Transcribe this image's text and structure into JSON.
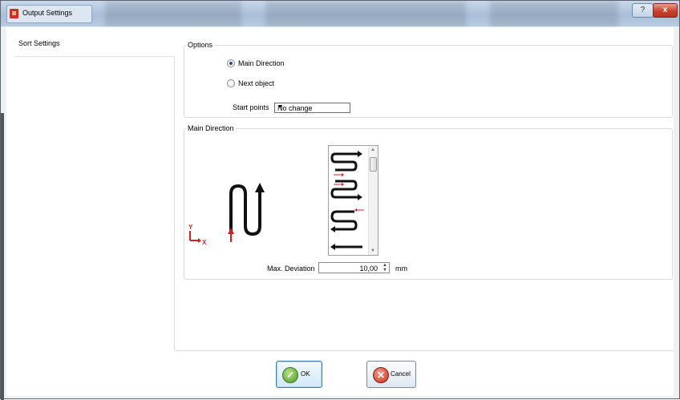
{
  "window": {
    "title": "Output Settings",
    "help_label": "?",
    "close_label": "x"
  },
  "sidebar": {
    "items": [
      {
        "label": "Sort Settings"
      }
    ]
  },
  "options": {
    "legend": "Options",
    "radio_main_direction": {
      "label": "Main Direction",
      "selected": true
    },
    "radio_next_object": {
      "label": "Next object",
      "selected": false
    },
    "start_points_label": "Start points",
    "start_points_value": "No change"
  },
  "main_direction": {
    "legend": "Main Direction",
    "axis_y": "Y",
    "axis_x": "X",
    "max_deviation_label": "Max. Deviation",
    "max_deviation_value": "10,00",
    "max_deviation_unit": "mm"
  },
  "buttons": {
    "ok": "OK",
    "cancel": "Cancel"
  },
  "colors": {
    "accent": "#c8321e",
    "arrow_red": "#d42020",
    "path_black": "#111111"
  }
}
